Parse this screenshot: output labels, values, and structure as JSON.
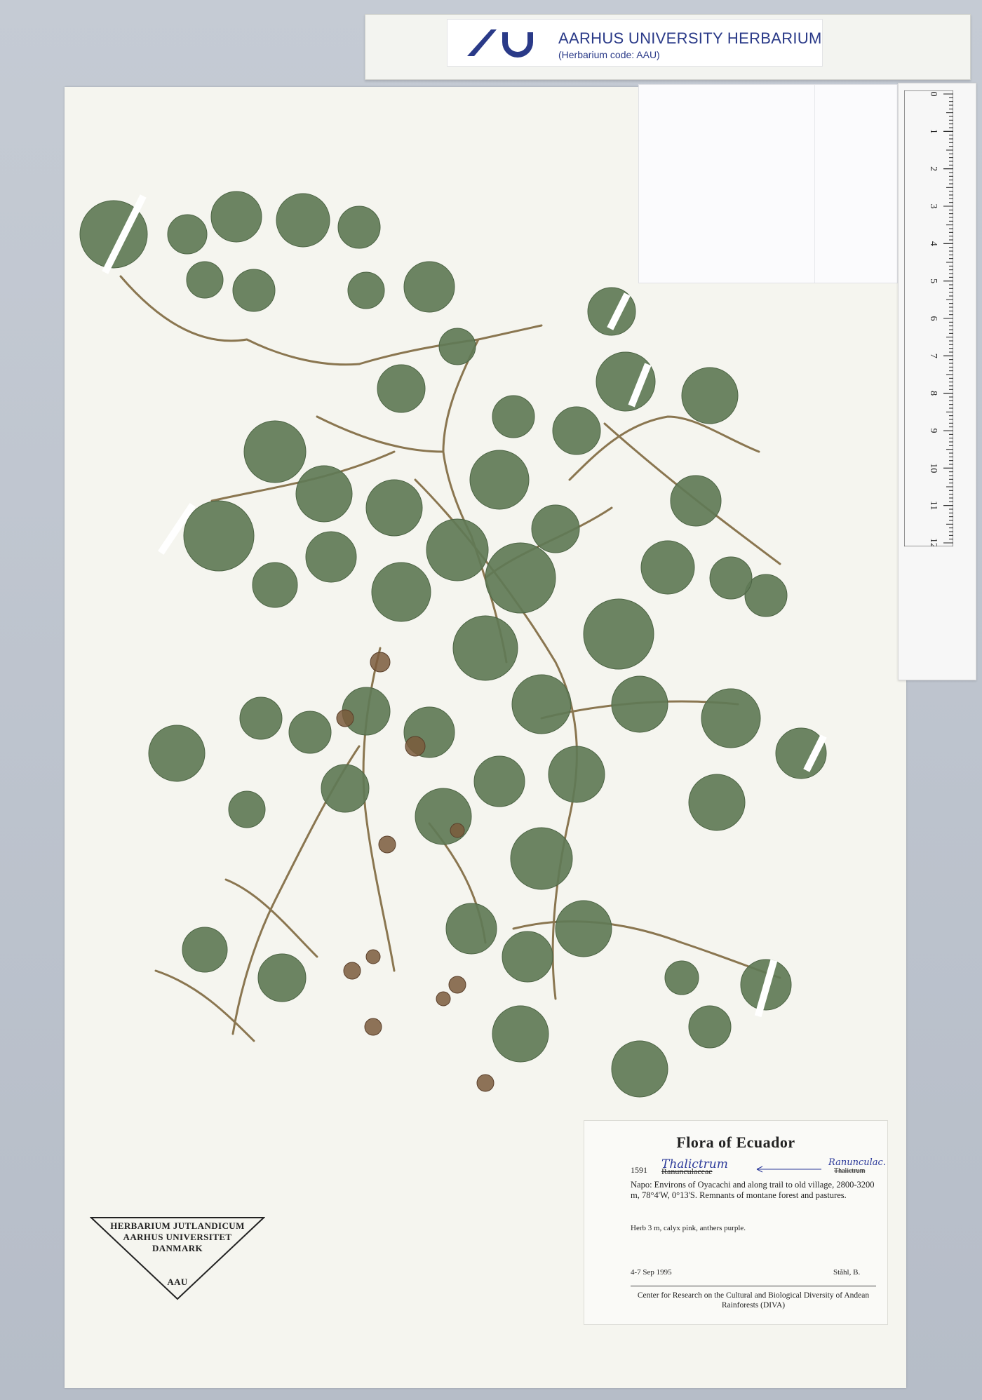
{
  "banner": {
    "title": "AARHUS UNIVERSITY HERBARIUM",
    "subtitle": "(Herbarium code: AAU)"
  },
  "ruler": {
    "marks": [
      "0",
      "1",
      "2",
      "3",
      "4",
      "5",
      "6",
      "7",
      "8",
      "9",
      "10",
      "11",
      "12"
    ]
  },
  "stamp": {
    "line1": "HERBARIUM JUTLANDICUM",
    "line2": "AARHUS UNIVERSITET",
    "line3": "DANMARK",
    "code": "AAU"
  },
  "label": {
    "title": "Flora of Ecuador",
    "number": "1591",
    "genus_handwritten": "Thalictrum",
    "family_struck": "Ranunculaceae",
    "family_handwritten": "Ranunculac.",
    "genus_struck": "Thalictrum",
    "locality": "Napo: Environs of Oyacachi and along trail to old village, 2800-3200 m, 78°4'W, 0°13'S. Remnants of montane forest and pastures.",
    "description": "Herb 3 m, calyx pink, anthers purple.",
    "date": "4-7 Sep 1995",
    "collector": "Ståhl,  B.",
    "institution": "Center for Research on the Cultural and Biological Diversity of Andean Rainforests (DIVA)"
  },
  "colors": {
    "leaf": "#5f7a56",
    "stem": "#8a7650",
    "brand": "#2a3a88",
    "sheet": "#f5f5ef"
  }
}
